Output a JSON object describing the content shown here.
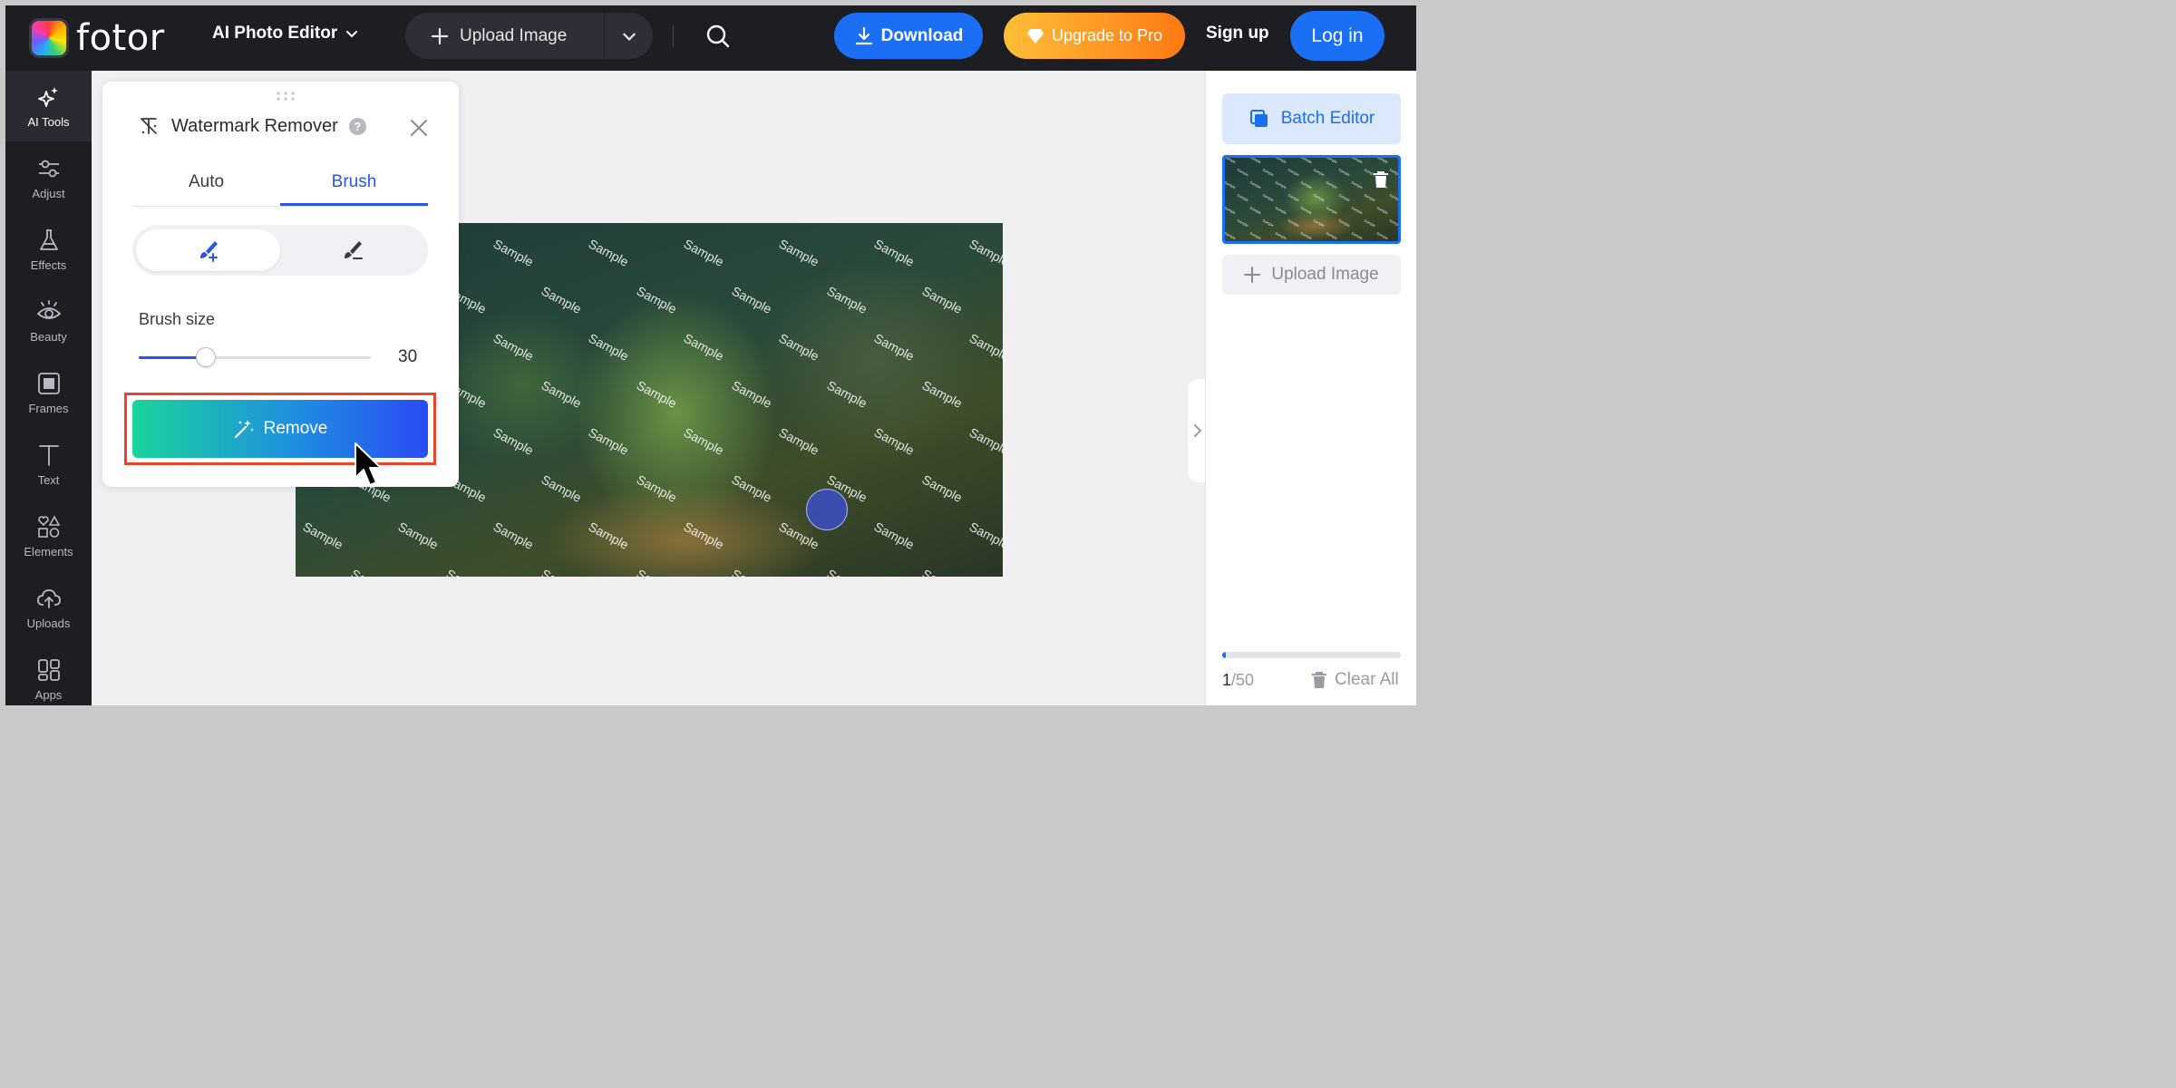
{
  "header": {
    "logo_text": "fotor",
    "editor_menu_label": "AI Photo Editor",
    "upload_label": "Upload Image",
    "download_label": "Download",
    "upgrade_label": "Upgrade to Pro",
    "signup_label": "Sign up",
    "login_label": "Log in",
    "accent_color": "#1a6ff5"
  },
  "sidebar": {
    "items": [
      {
        "label": "AI Tools",
        "icon": "sparkle-icon",
        "active": true
      },
      {
        "label": "Adjust",
        "icon": "sliders-icon"
      },
      {
        "label": "Effects",
        "icon": "flask-icon"
      },
      {
        "label": "Beauty",
        "icon": "eye-icon"
      },
      {
        "label": "Frames",
        "icon": "frame-icon"
      },
      {
        "label": "Text",
        "icon": "text-icon"
      },
      {
        "label": "Elements",
        "icon": "shapes-icon"
      },
      {
        "label": "Uploads",
        "icon": "cloud-upload-icon"
      },
      {
        "label": "Apps",
        "icon": "apps-icon"
      }
    ]
  },
  "panel": {
    "title": "Watermark Remover",
    "tabs": [
      {
        "label": "Auto",
        "active": false
      },
      {
        "label": "Brush",
        "active": true
      }
    ],
    "brush_modes": [
      {
        "icon": "brush-add-icon",
        "active": true
      },
      {
        "icon": "brush-erase-icon",
        "active": false
      }
    ],
    "brush_size_label": "Brush size",
    "brush_size_value": "30",
    "brush_size_fraction": 0.29,
    "remove_label": "Remove"
  },
  "canvas": {
    "watermark_text": "Sample"
  },
  "right_panel": {
    "batch_label": "Batch Editor",
    "upload_label": "Upload Image",
    "count_current": "1",
    "count_total": "/50",
    "progress_fraction": 0.02,
    "clear_label": "Clear All"
  }
}
